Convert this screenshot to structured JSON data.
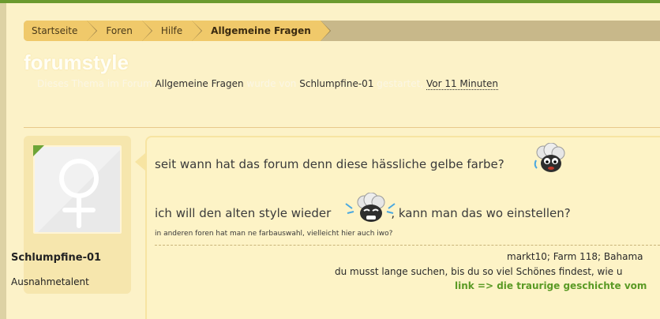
{
  "breadcrumb": {
    "items": [
      "Startseite",
      "Foren",
      "Hilfe",
      "Allgemeine Fragen"
    ]
  },
  "thread": {
    "title": "forumstyle",
    "meta": {
      "prefix": "Dieses Thema im Forum",
      "forum": "Allgemeine Fragen",
      "middle": "wurde von",
      "author": "Schlumpfine-01",
      "suffix": "gestartet,",
      "date": "Vor 11 Minuten"
    }
  },
  "author_box": {
    "name": "Schlumpfine-01",
    "rank": "Ausnahmetalent"
  },
  "post": {
    "line1": "seit wann hat das forum denn diese hässliche gelbe farbe?",
    "line2_before": "ich will den alten style wieder",
    "line2_after": ", kann man das wo einstellen?",
    "line3": "in anderen foren hat man ne farbauswahl, vielleicht hier auch iwo?"
  },
  "signature": {
    "line1": "markt10; Farm 118; Bahama",
    "line2": "du musst lange suchen, bis du so viel Schönes findest, wie u",
    "link": "link => die traurige geschichte vom"
  },
  "icons": {
    "avatar": "female-symbol-icon",
    "smiley1": "sheep-sad-icon",
    "smiley2": "sheep-crying-icon"
  },
  "colors": {
    "page_bg": "#fcf2c8",
    "accent_green": "#6b9a2e",
    "crumb_bg": "#f0c96a",
    "link_green": "#5a9a25"
  }
}
